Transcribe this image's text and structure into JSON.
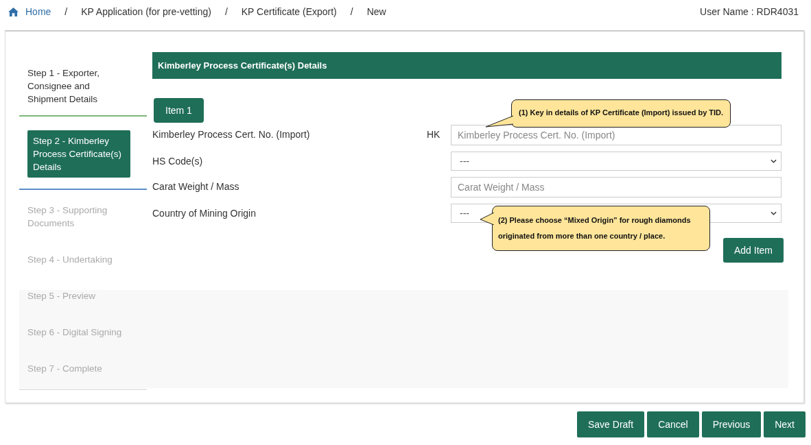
{
  "breadcrumb": [
    {
      "label": "Home",
      "link": true
    },
    {
      "label": "KP Application (for pre-vetting)",
      "link": false
    },
    {
      "label": "KP Certificate (Export)",
      "link": false
    },
    {
      "label": "New",
      "link": false
    }
  ],
  "separator": "/",
  "user": "User Name : RDR4031",
  "steps": [
    {
      "label": "Step 1 - Exporter, Consignee and Shipment Details",
      "selected": false,
      "disabled": false
    },
    {
      "label": "Step 2 - Kimberley Process Certificate(s) Details",
      "selected": true,
      "disabled": false
    },
    {
      "label": "Step 3 - Supporting Documents",
      "selected": false,
      "disabled": true
    },
    {
      "label": "Step 4 - Undertaking",
      "selected": false,
      "disabled": true
    },
    {
      "label": "Step 5 - Preview",
      "selected": false,
      "disabled": true
    },
    {
      "label": "Step 6 - Digital Signing",
      "selected": false,
      "disabled": true
    },
    {
      "label": "Step 7 - Complete",
      "selected": false,
      "disabled": true
    }
  ],
  "section_title": "Kimberley Process Certificate(s) Details",
  "item_tab": "Item 1",
  "fields": [
    {
      "kind": "text",
      "label": "Kimberley Process Cert. No. (Import)",
      "prefix": "HK",
      "placeholder": "Kimberley Process Cert. No. (Import)"
    },
    {
      "kind": "select",
      "label": "HS Code(s)",
      "value": "---"
    },
    {
      "kind": "text",
      "label": "Carat Weight / Mass",
      "placeholder": "Carat Weight / Mass"
    },
    {
      "kind": "select",
      "label": "Country of Mining Origin",
      "value": "---"
    }
  ],
  "add_button": "Add Item",
  "callouts": [
    "(1) Key in details of KP Certificate (Import) issued by TID.",
    "(2) Please choose “Mixed Origin” for rough diamonds originated from more than one country / place."
  ],
  "buttons": [
    "Save Draft",
    "Cancel",
    "Previous",
    "Next"
  ]
}
